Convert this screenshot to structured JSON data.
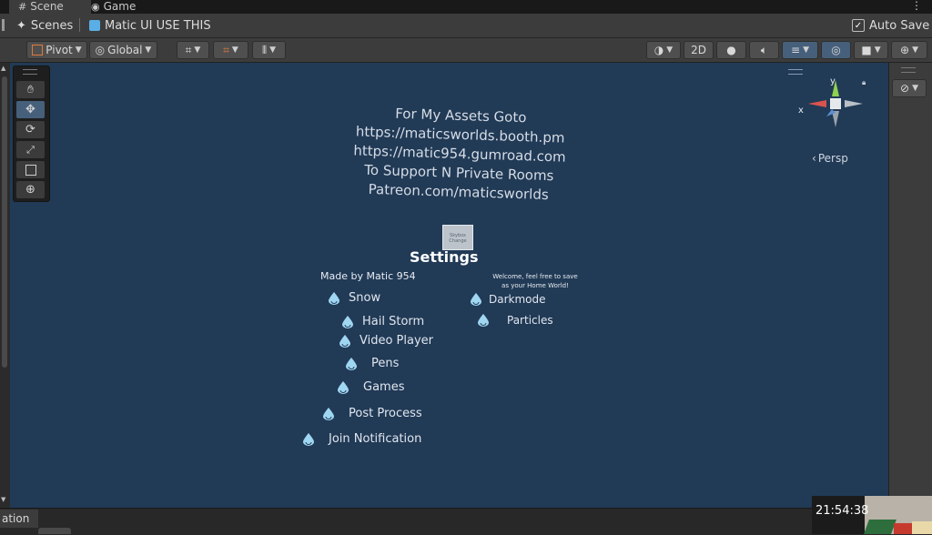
{
  "tabs": [
    {
      "label": "Scene",
      "icon": "grid-icon",
      "active": true
    },
    {
      "label": "Game",
      "icon": "gamepad-icon",
      "active": false
    }
  ],
  "breadcrumb": {
    "root": "Scenes",
    "current": "Matic UI USE THIS"
  },
  "auto_save": {
    "label": "Auto Save",
    "checked": true
  },
  "toolbar": {
    "pivot": "Pivot",
    "global": "Global",
    "mode_2d": "2D"
  },
  "gizmo": {
    "x_label": "x",
    "y_label": "y",
    "persp": "Persp"
  },
  "scene_text": {
    "lines": [
      "For My Assets Goto",
      "https://maticsworlds.booth.pm",
      "https://matic954.gumroad.com",
      "To Support N Private Rooms",
      "Patreon.com/maticsworlds"
    ],
    "skybox_box": [
      "Skybox",
      "Change"
    ],
    "settings_title": "Settings",
    "made_by": "Made by Matic 954",
    "welcome": [
      "Welcome, feel free to save",
      "as your Home World!"
    ],
    "left_options": [
      "Snow",
      "Hail Storm",
      "Video Player",
      "Pens",
      "Games",
      "Post Process",
      "Join Notification"
    ],
    "right_options": [
      "Darkmode",
      "Particles"
    ]
  },
  "bottom": {
    "tab_label": "ation",
    "clock": "21:54:38"
  },
  "colors": {
    "scene_bg": "#213a56",
    "drop_icon": "#9fd6f2",
    "gizmo_x": "#d9534f",
    "gizmo_y": "#8fd14f"
  }
}
